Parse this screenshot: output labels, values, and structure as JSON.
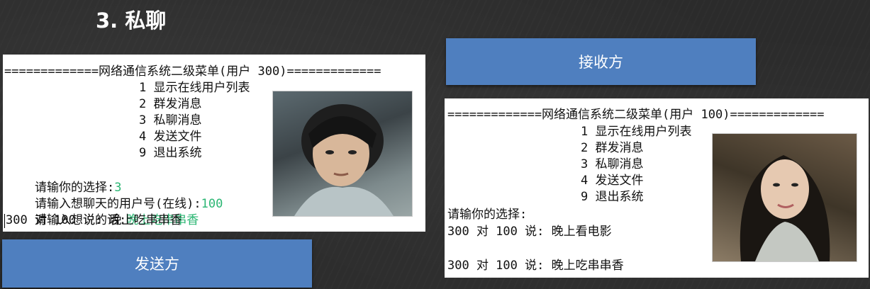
{
  "slide": {
    "title": "3. 私聊"
  },
  "sender": {
    "label": "发送方",
    "menu_header": "=============网络通信系统二级菜单(用户 300)=============",
    "menu_items": [
      "1 显示在线用户列表",
      "2 群发消息",
      "3 私聊消息",
      "4 发送文件",
      "9 退出系统"
    ],
    "prompt_choice": "请输你的选择:",
    "choice_value": "3",
    "prompt_user": "请输入想聊天的用户号(在线):",
    "user_value": "100",
    "prompt_message": "请输入想说的话:",
    "message_value": "晚上吃串串香",
    "echo": "300 对 100 说: 晚上吃串串香"
  },
  "receiver": {
    "label": "接收方",
    "menu_header": "=============网络通信系统二级菜单(用户 100)=============",
    "menu_items": [
      "1 显示在线用户列表",
      "2 群发消息",
      "3 私聊消息",
      "4 发送文件",
      "9 退出系统"
    ],
    "prompt_choice": "请输你的选择:",
    "message_1": "300 对 100 说: 晚上看电影",
    "message_2": "300 对 100 说: 晚上吃串串香"
  }
}
